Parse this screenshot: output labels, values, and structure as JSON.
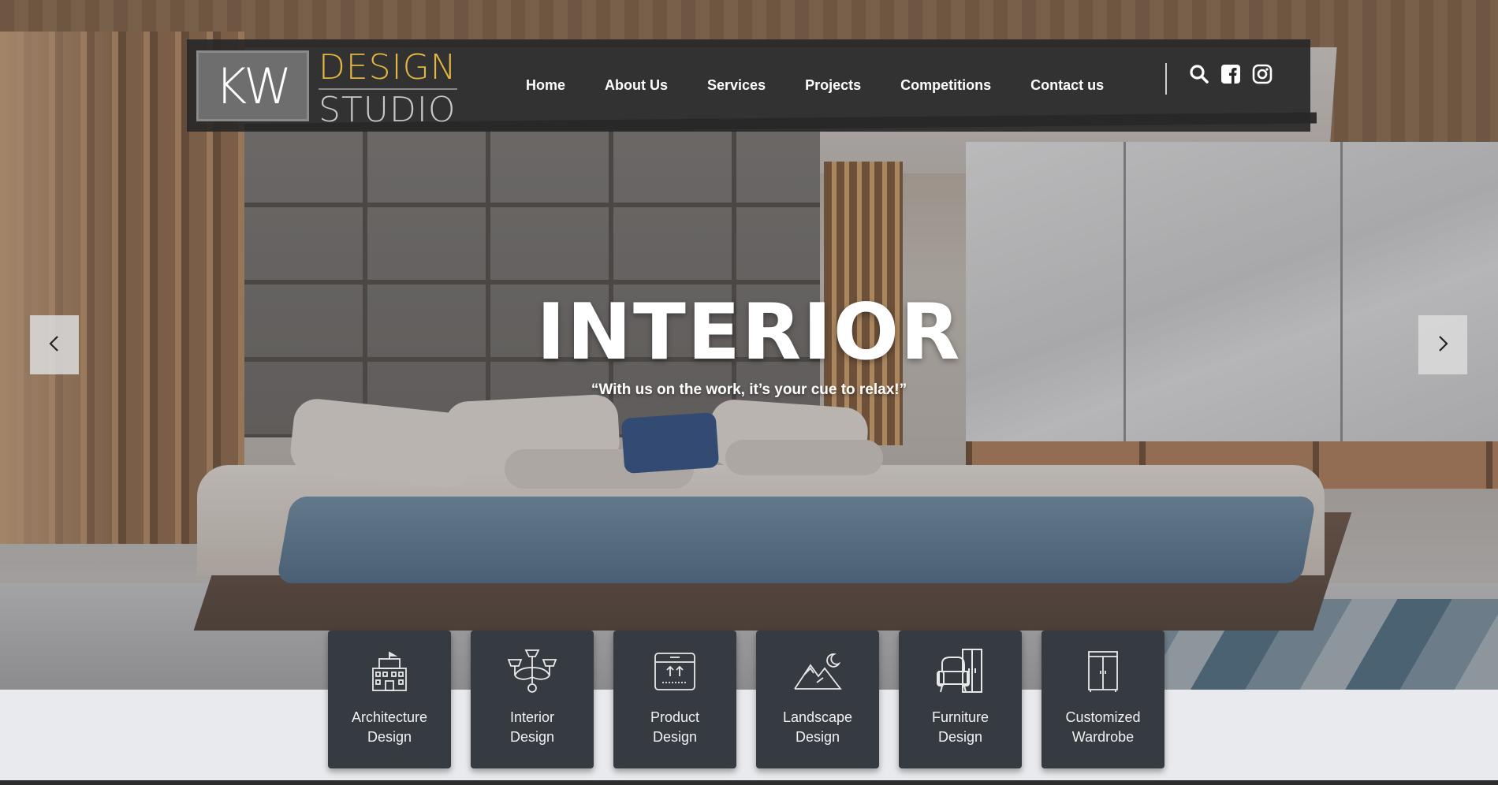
{
  "brand": {
    "mark": "KW",
    "line1": "DESIGN",
    "line2": "STUDIO",
    "accent_color": "#e3b641"
  },
  "nav": {
    "items": [
      "Home",
      "About Us",
      "Services",
      "Projects",
      "Competitions",
      "Contact us"
    ],
    "icons": [
      "search-icon",
      "facebook-icon",
      "instagram-icon"
    ]
  },
  "hero": {
    "title": "INTERIOR",
    "subtitle": "“With us on the work, it’s your cue to relax!”",
    "prev_icon": "chevron-left-icon",
    "next_icon": "chevron-right-icon"
  },
  "services": [
    {
      "line1": "Architecture",
      "line2": "Design",
      "icon": "building-icon"
    },
    {
      "line1": "Interior",
      "line2": "Design",
      "icon": "chandelier-icon"
    },
    {
      "line1": "Product",
      "line2": "Design",
      "icon": "box-icon"
    },
    {
      "line1": "Landscape",
      "line2": "Design",
      "icon": "mountain-moon-icon"
    },
    {
      "line1": "Furniture",
      "line2": "Design",
      "icon": "armchair-icon"
    },
    {
      "line1": "Customized",
      "line2": "Wardrobe",
      "icon": "wardrobe-icon"
    }
  ],
  "colors": {
    "navbar_bg": "#282828",
    "card_bg": "#363a41",
    "page_bg": "#e9eaee"
  }
}
